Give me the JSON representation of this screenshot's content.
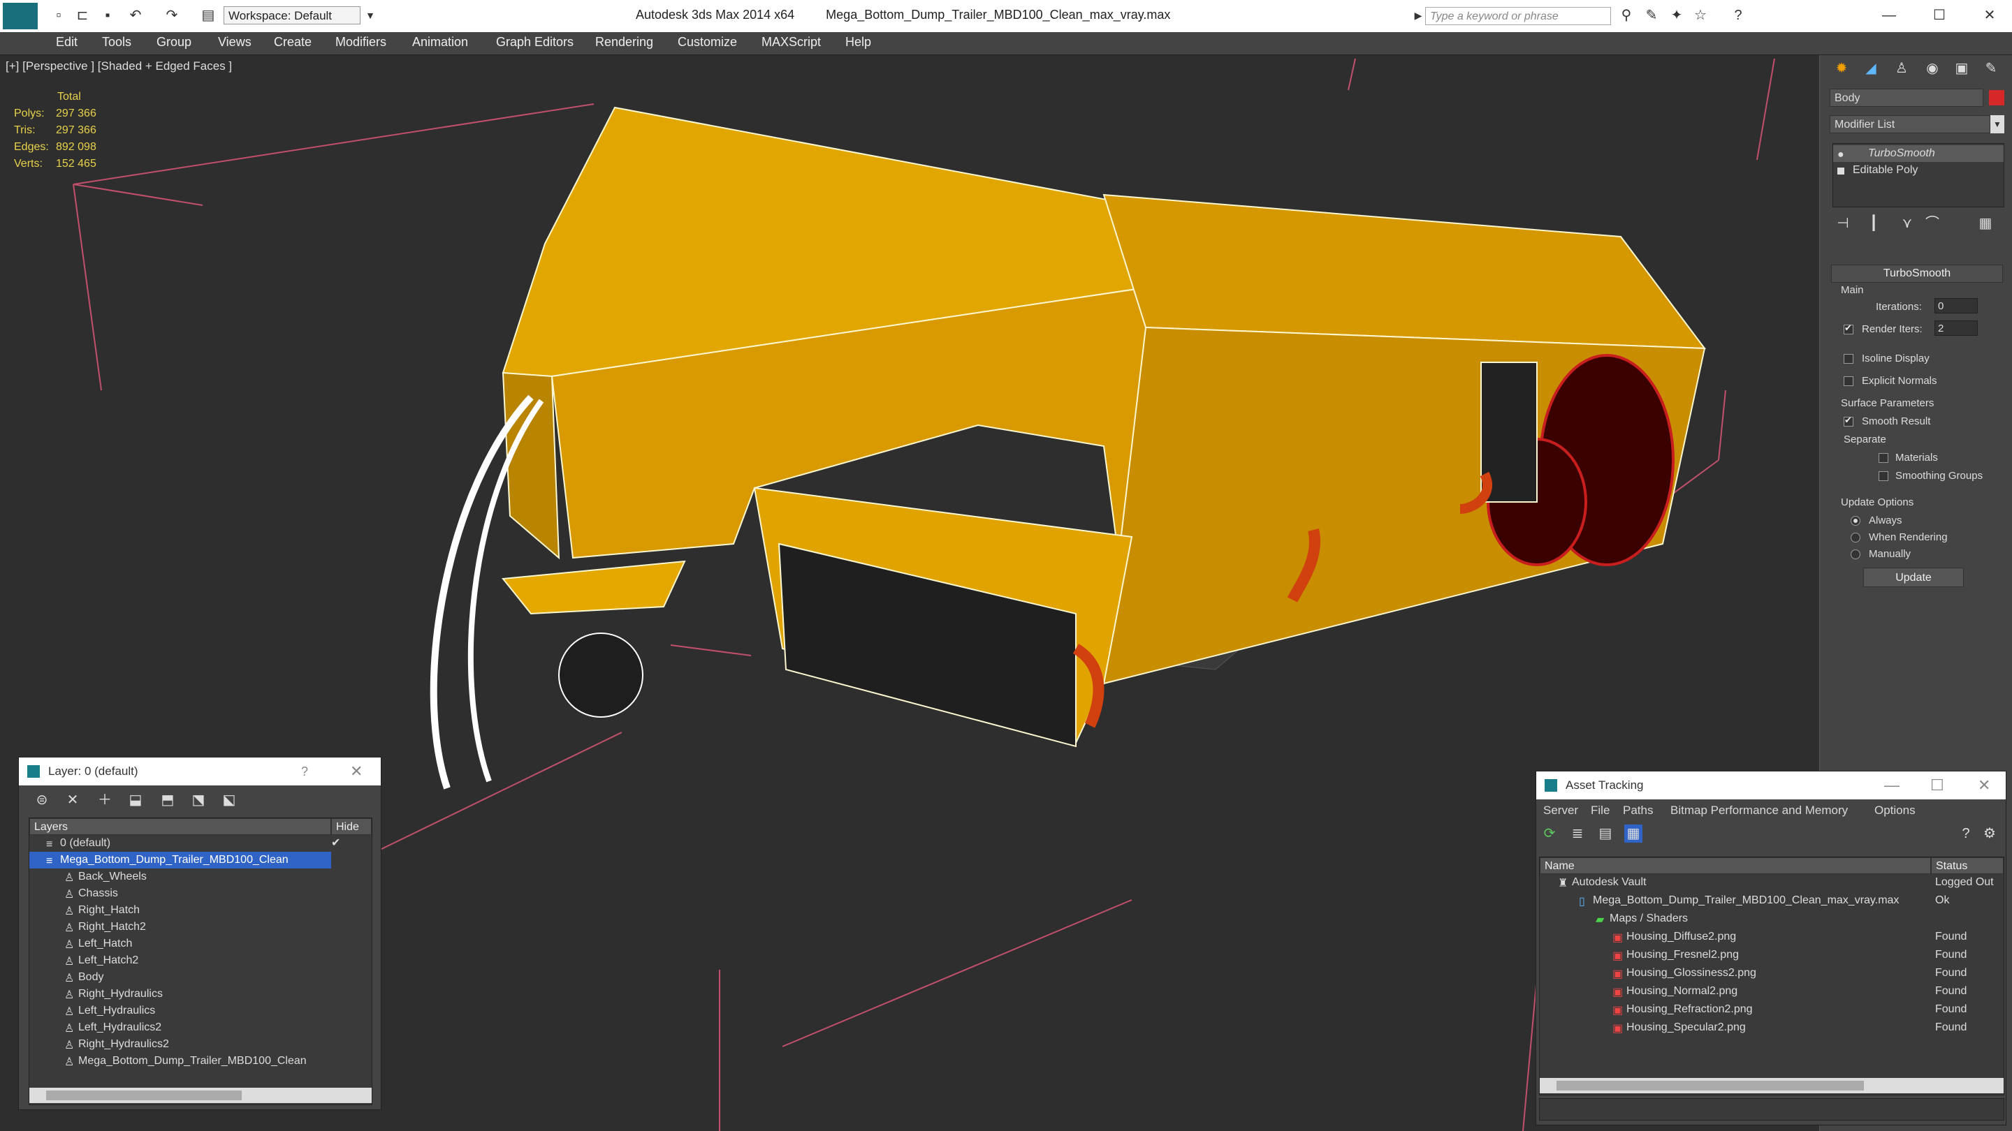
{
  "window": {
    "app_title": "Autodesk 3ds Max  2014 x64",
    "file_title": "Mega_Bottom_Dump_Trailer_MBD100_Clean_max_vray.max",
    "workspace": "Workspace: Default",
    "search_placeholder": "Type a keyword or phrase"
  },
  "menu": [
    "Edit",
    "Tools",
    "Group",
    "Views",
    "Create",
    "Modifiers",
    "Animation",
    "Graph Editors",
    "Rendering",
    "Customize",
    "MAXScript",
    "Help"
  ],
  "viewport": {
    "label": "[+] [Perspective ] [Shaded + Edged Faces ]",
    "stats": {
      "header": "Total",
      "rows": [
        {
          "label": "Polys:",
          "value": "297 366"
        },
        {
          "label": "Tris:",
          "value": "297 366"
        },
        {
          "label": "Edges:",
          "value": "892 098"
        },
        {
          "label": "Verts:",
          "value": "152 465"
        }
      ]
    }
  },
  "command_panel": {
    "object_name": "Body",
    "object_color": "#d62828",
    "modifier_list": "Modifier List",
    "stack": [
      "TurboSmooth",
      "Editable Poly"
    ],
    "turbosmooth": {
      "title": "TurboSmooth",
      "main": "Main",
      "iterations_label": "Iterations:",
      "iterations": "0",
      "render_iters_label": "Render Iters:",
      "render_iters": "2",
      "isoline": "Isoline Display",
      "explicit": "Explicit Normals",
      "surface": "Surface Parameters",
      "smooth_result": "Smooth Result",
      "separate": "Separate",
      "materials": "Materials",
      "smoothing_groups": "Smoothing Groups",
      "update_options": "Update Options",
      "always": "Always",
      "when_rendering": "When Rendering",
      "manually": "Manually",
      "update_btn": "Update"
    }
  },
  "layer_window": {
    "title": "Layer: 0 (default)",
    "col_layers": "Layers",
    "col_hide": "Hide",
    "rows": [
      {
        "name": "0 (default)",
        "level": 0,
        "selected": false
      },
      {
        "name": "Mega_Bottom_Dump_Trailer_MBD100_Clean",
        "level": 0,
        "selected": true
      },
      {
        "name": "Back_Wheels",
        "level": 1,
        "selected": false
      },
      {
        "name": "Chassis",
        "level": 1,
        "selected": false
      },
      {
        "name": "Right_Hatch",
        "level": 1,
        "selected": false
      },
      {
        "name": "Right_Hatch2",
        "level": 1,
        "selected": false
      },
      {
        "name": "Left_Hatch",
        "level": 1,
        "selected": false
      },
      {
        "name": "Left_Hatch2",
        "level": 1,
        "selected": false
      },
      {
        "name": "Body",
        "level": 1,
        "selected": false
      },
      {
        "name": "Right_Hydraulics",
        "level": 1,
        "selected": false
      },
      {
        "name": "Left_Hydraulics",
        "level": 1,
        "selected": false
      },
      {
        "name": "Left_Hydraulics2",
        "level": 1,
        "selected": false
      },
      {
        "name": "Right_Hydraulics2",
        "level": 1,
        "selected": false
      },
      {
        "name": "Mega_Bottom_Dump_Trailer_MBD100_Clean",
        "level": 1,
        "selected": false
      }
    ]
  },
  "asset_window": {
    "title": "Asset Tracking",
    "menu": [
      "Server",
      "File",
      "Paths",
      "Bitmap Performance and Memory",
      "Options"
    ],
    "col_name": "Name",
    "col_status": "Status",
    "rows": [
      {
        "name": "Autodesk Vault",
        "status": "Logged Out",
        "level": 0
      },
      {
        "name": "Mega_Bottom_Dump_Trailer_MBD100_Clean_max_vray.max",
        "status": "Ok",
        "level": 1
      },
      {
        "name": "Maps / Shaders",
        "status": "",
        "level": 2
      },
      {
        "name": "Housing_Diffuse2.png",
        "status": "Found",
        "level": 3
      },
      {
        "name": "Housing_Fresnel2.png",
        "status": "Found",
        "level": 3
      },
      {
        "name": "Housing_Glossiness2.png",
        "status": "Found",
        "level": 3
      },
      {
        "name": "Housing_Normal2.png",
        "status": "Found",
        "level": 3
      },
      {
        "name": "Housing_Refraction2.png",
        "status": "Found",
        "level": 3
      },
      {
        "name": "Housing_Specular2.png",
        "status": "Found",
        "level": 3
      }
    ]
  }
}
